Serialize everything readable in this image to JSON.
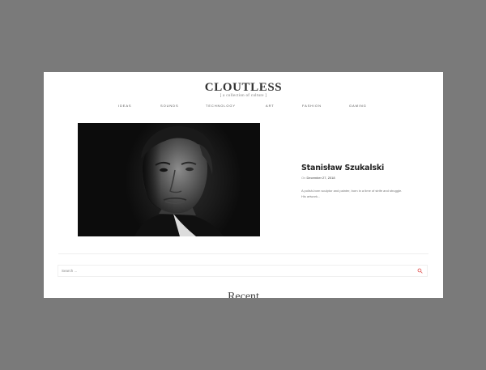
{
  "site": {
    "title": "CLOUTLESS",
    "tagline": "[ a collection of culture ]"
  },
  "nav": {
    "items": [
      {
        "label": "IDEAS"
      },
      {
        "label": "SOUNDS"
      },
      {
        "label": "TECHNOLOGY"
      },
      {
        "label": "ART"
      },
      {
        "label": "FASHION"
      },
      {
        "label": "GAMING"
      }
    ]
  },
  "featured": {
    "title": "Stanisław Szukalski",
    "meta_prefix": "On",
    "date": "December 27, 2018",
    "excerpt": "A polish-born sculptor and painter, born in a time of strife and struggle. His artwork..."
  },
  "search": {
    "placeholder": "Search ...",
    "icon": "magnifier-icon",
    "icon_color": "#e0514f"
  },
  "recent": {
    "heading": "Recent"
  }
}
